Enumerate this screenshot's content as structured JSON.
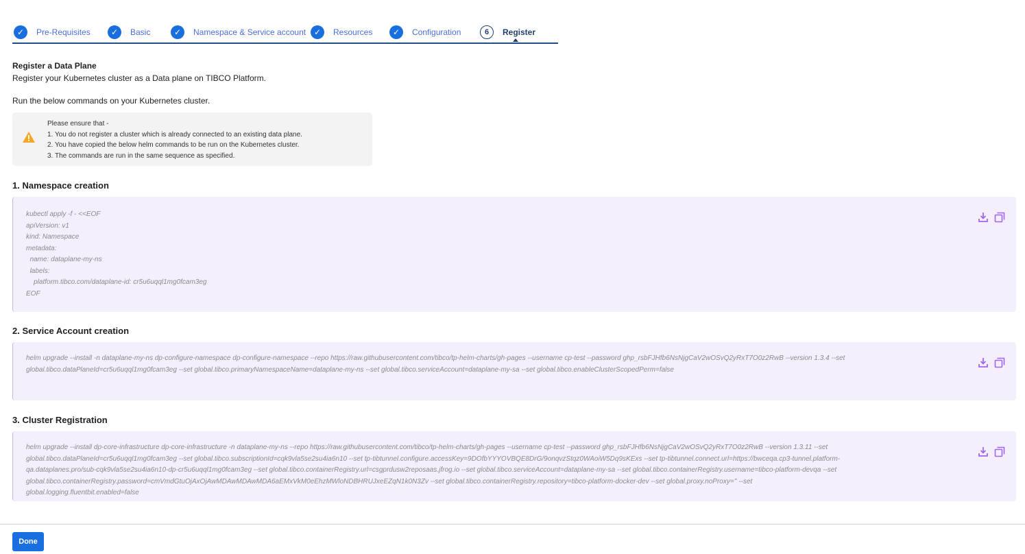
{
  "stepper": {
    "steps": [
      {
        "label": "Pre-Requisites",
        "state": "done"
      },
      {
        "label": "Basic",
        "state": "done"
      },
      {
        "label": "Namespace & Service account",
        "state": "done"
      },
      {
        "label": "Resources",
        "state": "done"
      },
      {
        "label": "Configuration",
        "state": "done"
      },
      {
        "label": "Register",
        "state": "active",
        "number": "6"
      }
    ]
  },
  "intro": {
    "title": "Register a Data Plane",
    "subtitle": "Register your Kubernetes cluster as a Data plane on TIBCO Platform.",
    "instruction": "Run the below commands on your Kubernetes cluster."
  },
  "alert": {
    "heading": "Please ensure that -",
    "items": [
      "1. You do not register a cluster which is already connected to an existing data plane.",
      "2. You have copied the below helm commands to be run on the Kubernetes cluster.",
      "3. The commands are run in the same sequence as specified."
    ]
  },
  "sections": [
    {
      "title": "1. Namespace creation",
      "code": "kubectl apply -f - <<EOF\napiVersion: v1\nkind: Namespace\nmetadata:\n  name: dataplane-my-ns\n  labels:\n    platform.tibco.com/dataplane-id: cr5u6uqql1mg0fcam3eg\nEOF"
    },
    {
      "title": "2. Service Account creation",
      "code": "helm upgrade --install -n dataplane-my-ns dp-configure-namespace dp-configure-namespace --repo https://raw.githubusercontent.com/tibco/tp-helm-charts/gh-pages --username cp-test --password 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 --version 1.3.4 --set global.tibco.dataPlaneId=cr5u6uqql1mg0fcam3eg --set global.tibco.primaryNamespaceName=dataplane-my-ns --set global.tibco.serviceAccount=dataplane-my-sa --set global.tibco.enableClusterScopedPerm=false"
    },
    {
      "title": "3. Cluster Registration",
      "code": "helm upgrade --install dp-core-infrastructure dp-core-infrastructure -n dataplane-my-ns --repo https://raw.githubusercontent.com/tibco/tp-helm-charts/gh-pages --username cp-test --password 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 --version 1.3.11 --set global.tibco.dataPlaneId=cr5u6uqql1mg0fcam3eg --set global.tibco.subscriptionId=cqk9vla5se2su4ia6n10 --set tp-tibtunnel.configure.accessKey=9DOfbYYYOVBQE8DrG/9onqvzStqz0WAoiW5Dq9sKExs --set tp-tibtunnel.connect.url=https://bwceqa.cp3-tunnel.platform-qa.dataplanes.pro/sub-cqk9vla5se2su4ia6n10-dp-cr5u6uqql1mg0fcam3eg --set global.tibco.containerRegistry.url=csgprdusw2reposaas.jfrog.io --set global.tibco.serviceAccount=dataplane-my-sa --set global.tibco.containerRegistry.username=tibco-platform-devqa --set global.tibco.containerRegistry.password=cmVmdGtuOjAxOjAwMDAwMDAwMDA6aEMxVkM0eEhzMWloNDBHRUJxeEZqN1k0N3Zv --set global.tibco.containerRegistry.repository=tibco-platform-docker-dev --set global.proxy.noProxy='' --set global.logging.fluentbit.enabled=false"
    }
  ],
  "footer": {
    "done_label": "Done"
  },
  "colors": {
    "accent": "#1a6fe0",
    "code_bg": "#f5effd",
    "icon": "#a066f0",
    "warning": "#f5a623"
  }
}
